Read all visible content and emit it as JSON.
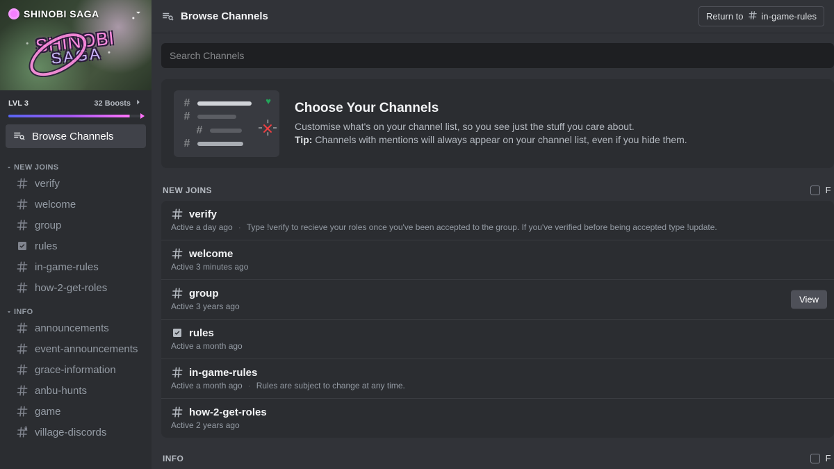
{
  "server": {
    "name": "SHINOBI SAGA",
    "wordmark_line1": "SHINOBI",
    "wordmark_line2": "SAGA",
    "level_label": "LVL 3",
    "boost_count_label": "32 Boosts",
    "browse_label": "Browse Channels"
  },
  "sidebar": {
    "cat1": {
      "name": "NEW JOINS"
    },
    "cat2": {
      "name": "INFO"
    },
    "c": {
      "verify": "verify",
      "welcome": "welcome",
      "group": "group",
      "rules": "rules",
      "ingame": "in-game-rules",
      "howroles": "how-2-get-roles",
      "ann": "announcements",
      "eventann": "event-announcements",
      "grace": "grace-information",
      "anbu": "anbu-hunts",
      "game": "game",
      "village": "village-discords"
    }
  },
  "topbar": {
    "title": "Browse Channels",
    "return_prefix": "Return to",
    "return_channel": "in-game-rules"
  },
  "search": {
    "placeholder": "Search Channels"
  },
  "hero": {
    "title": "Choose Your Channels",
    "line1": "Customise what's on your channel list, so you see just the stuff you care about.",
    "tip_label": "Tip:",
    "tip_text": " Channels with mentions will always appear on your channel list, even if you hide them."
  },
  "section1": {
    "title": "NEW JOINS",
    "follow_letter": "F"
  },
  "section2": {
    "title": "INFO",
    "follow_letter": "F"
  },
  "rows": {
    "verify": {
      "name": "verify",
      "active": "Active a day ago",
      "desc": "Type !verify to recieve your roles once you've been accepted to the group. If you've verified before being accepted type !update."
    },
    "welcome": {
      "name": "welcome",
      "active": "Active 3 minutes ago"
    },
    "group": {
      "name": "group",
      "active": "Active 3 years ago",
      "view": "View"
    },
    "rules": {
      "name": "rules",
      "active": "Active a month ago"
    },
    "ingame": {
      "name": "in-game-rules",
      "active": "Active a month ago",
      "desc": "Rules are subject to change at any time."
    },
    "howroles": {
      "name": "how-2-get-roles",
      "active": "Active 2 years ago"
    }
  }
}
